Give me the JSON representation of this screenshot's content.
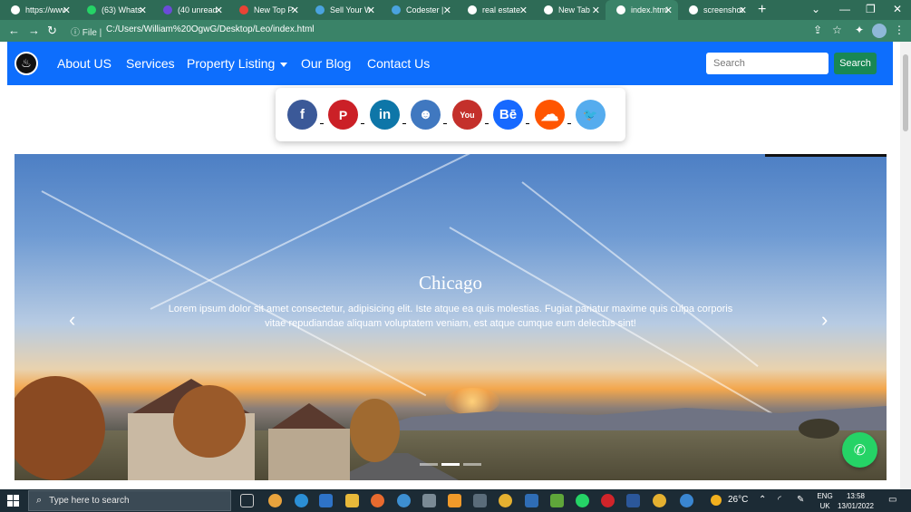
{
  "browser": {
    "tabs": [
      {
        "label": "https://www",
        "active": false
      },
      {
        "label": "(63) Whatsa",
        "active": false
      },
      {
        "label": "(40 unread)",
        "active": false
      },
      {
        "label": "New Top P",
        "active": false
      },
      {
        "label": "Sell Your W",
        "active": false
      },
      {
        "label": "Codester | C",
        "active": false
      },
      {
        "label": "real estate",
        "active": false
      },
      {
        "label": "New Tab",
        "active": false
      },
      {
        "label": "index.html",
        "active": true
      },
      {
        "label": "screenshot",
        "active": false
      }
    ],
    "address_prefix": "File",
    "url": "C:/Users/William%20OgwG/Desktop/Leo/index.html"
  },
  "site_nav": {
    "links": [
      "About US",
      "Services",
      "Property Listing",
      "Our Blog",
      "Contact Us"
    ],
    "search_placeholder": "Search",
    "search_button": "Search"
  },
  "social": [
    {
      "name": "facebook",
      "glyph": "f",
      "color": "#3b5998"
    },
    {
      "name": "pinterest",
      "glyph": "P",
      "color": "#cb2027"
    },
    {
      "name": "linkedin",
      "glyph": "in",
      "color": "#0e76a8"
    },
    {
      "name": "github",
      "glyph": "☻",
      "color": "#4078c0"
    },
    {
      "name": "youtube",
      "glyph": "You",
      "color": "#c4302b"
    },
    {
      "name": "behance",
      "glyph": "Bē",
      "color": "#1769ff"
    },
    {
      "name": "soundcloud",
      "glyph": "☁",
      "color": "#ff5500"
    },
    {
      "name": "twitter",
      "glyph": "🐦",
      "color": "#55acee"
    }
  ],
  "carousel": {
    "title": "Chicago",
    "text": "Lorem ipsum dolor sit amet consectetur, adipisicing elit. Iste atque ea quis molestias. Fugiat pariatur maxime quis culpa corporis vitae repudiandae aliquam voluptatem veniam, est atque cumque eum delectus sint!",
    "slides": 3,
    "active_slide": 2
  },
  "taskbar": {
    "search_placeholder": "Type here to search",
    "weather": "26°C",
    "lang_line1": "ENG",
    "lang_line2": "UK",
    "time": "13:58",
    "date": "13/01/2022"
  }
}
